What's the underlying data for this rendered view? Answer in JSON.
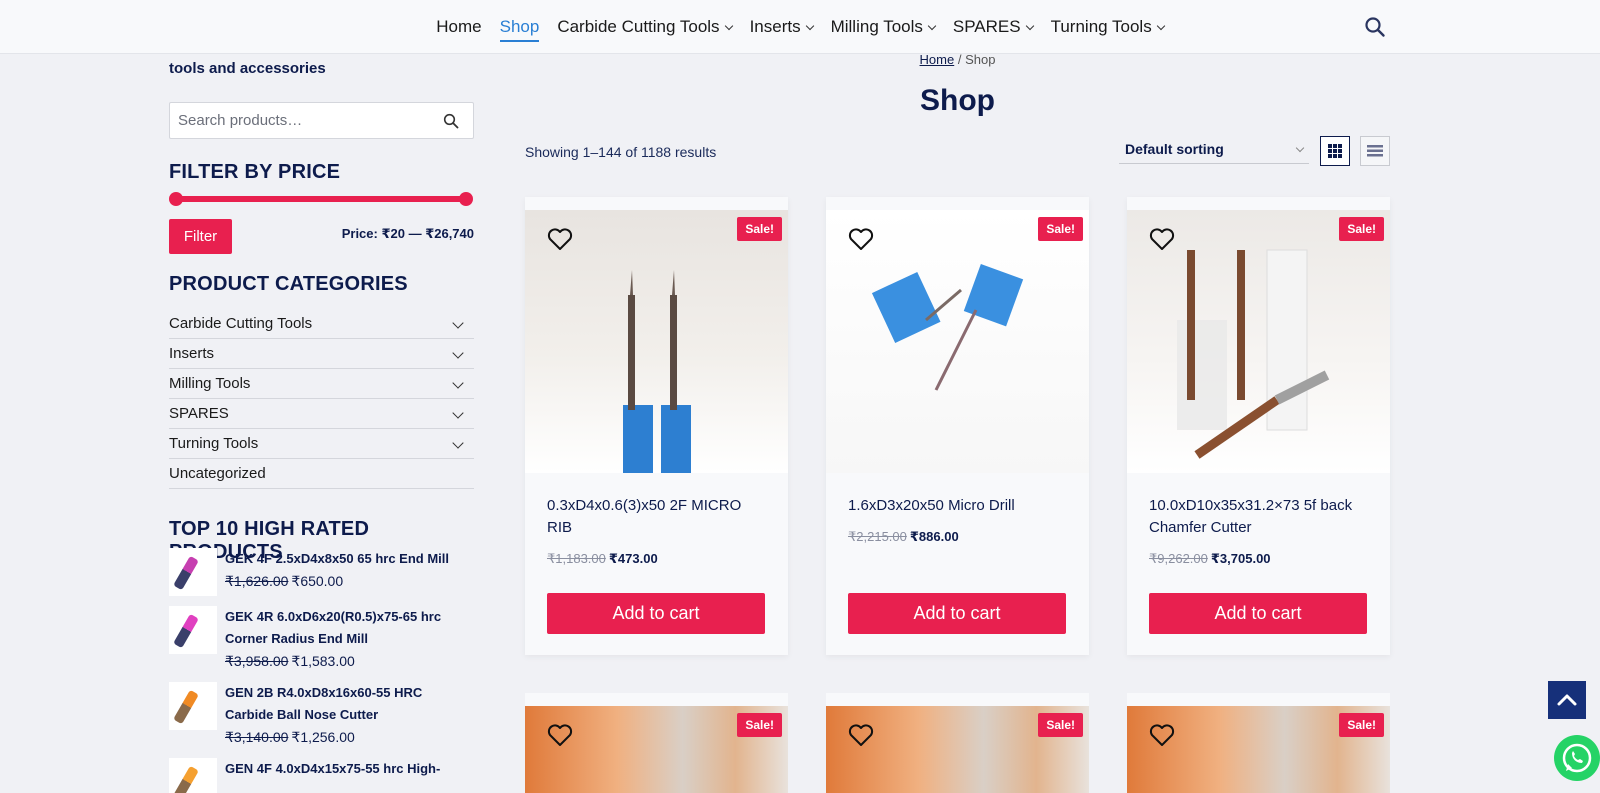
{
  "nav": {
    "items": [
      {
        "label": "Home",
        "dropdown": false,
        "active": false
      },
      {
        "label": "Shop",
        "dropdown": false,
        "active": true
      },
      {
        "label": "Carbide Cutting Tools",
        "dropdown": true,
        "active": false
      },
      {
        "label": "Inserts",
        "dropdown": true,
        "active": false
      },
      {
        "label": "Milling Tools",
        "dropdown": true,
        "active": false
      },
      {
        "label": "SPARES",
        "dropdown": true,
        "active": false
      },
      {
        "label": "Turning Tools",
        "dropdown": true,
        "active": false
      }
    ],
    "search_icon": "search-icon"
  },
  "sidebar": {
    "intro_text": "tools and accessories",
    "search": {
      "placeholder": "Search products…"
    },
    "filter": {
      "title": "FILTER BY PRICE",
      "button_label": "Filter",
      "price_label": "Price: ₹20 — ₹26,740"
    },
    "categories": {
      "title": "PRODUCT CATEGORIES",
      "items": [
        {
          "label": "Carbide Cutting Tools",
          "expandable": true
        },
        {
          "label": "Inserts",
          "expandable": true
        },
        {
          "label": "Milling Tools",
          "expandable": true
        },
        {
          "label": "SPARES",
          "expandable": true
        },
        {
          "label": "Turning Tools",
          "expandable": true
        },
        {
          "label": "Uncategorized",
          "expandable": false
        }
      ]
    },
    "top_rated": {
      "title": "TOP 10 HIGH RATED PRODUCTS",
      "items": [
        {
          "name": "GEK 4F 2.5xD4x8x50 65 hrc End Mill",
          "old_price": "₹1,626.00",
          "price": "₹650.00",
          "color": "#c63fb0"
        },
        {
          "name": "GEK 4R 6.0xD6x20(R0.5)x75-65 hrc Corner Radius End Mill",
          "old_price": "₹3,958.00",
          "price": "₹1,583.00",
          "color": "#e040c0"
        },
        {
          "name": "GEN 2B R4.0xD8x16x60-55 HRC Carbide Ball Nose Cutter",
          "old_price": "₹3,140.00",
          "price": "₹1,256.00",
          "color": "#f08a24"
        },
        {
          "name": "GEN 4F 4.0xD4x15x75-55 hrc High-",
          "old_price": "",
          "price": "",
          "color": "#f5a030"
        }
      ]
    }
  },
  "main": {
    "breadcrumb": {
      "home": "Home",
      "separator": "/",
      "current": "Shop"
    },
    "title": "Shop",
    "result_count": "Showing 1–144 of 1188 results",
    "sorting": {
      "selected": "Default sorting"
    },
    "view_modes": [
      "grid-view-icon",
      "list-view-icon"
    ],
    "sale_badge": "Sale!",
    "add_to_cart_label": "Add to cart",
    "products": [
      {
        "title": "0.3xD4x0.6(3)x50 2F MICRO RIB",
        "old_price": "₹1,183.00",
        "price": "₹473.00"
      },
      {
        "title": "1.6xD3x20x50 Micro Drill",
        "old_price": "₹2,215.00",
        "price": "₹886.00"
      },
      {
        "title": "10.0xD10x35x31.2×73 5f back Chamfer Cutter",
        "old_price": "₹9,262.00",
        "price": "₹3,705.00"
      }
    ]
  },
  "colors": {
    "accent": "#e8204f",
    "navy": "#0d1b4c",
    "link_active": "#2a7fd4",
    "whatsapp": "#25d366"
  }
}
